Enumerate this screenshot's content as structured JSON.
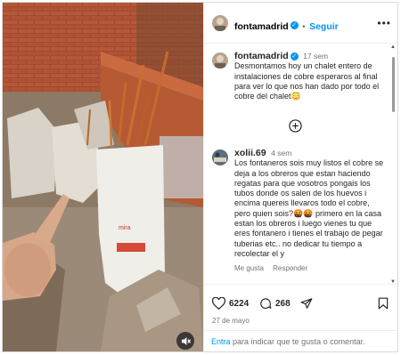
{
  "post": {
    "author": "fontamadrid",
    "follow_label": "Seguir",
    "dot": "•",
    "more": "•••",
    "caption_author": "fontamadrid",
    "caption_time": "17 sem",
    "caption_text": "Desmontamos hoy un chalet entero de instalaciones de cobre esperaros al final para ver lo que nos han dado por todo el cobre del chalet",
    "caption_emoji": "😳"
  },
  "comment": {
    "author": "xolii.69",
    "time": "4 sem",
    "text": "Los fontaneros sois muy listos el cobre se deja a los obreros que estan haciendo regatas para que vosotros pongais los tubos donde os salen de los huevos i encima quereis llevaros todo el cobre, pero quien sois?🤬🤬 primero en la casa estan los obreros i luego vienes tu que eres fontanero i tienes el trabajo de pegar tuberias etc.. no dedicar tu tiempo a recolectar el y",
    "like_label": "Me gusta",
    "reply_label": "Responder"
  },
  "actions": {
    "likes": "6224",
    "comments": "268",
    "date": "27 de mayo"
  },
  "footer": {
    "link": "Entra",
    "rest": " para indicar que te gusta o comentar."
  },
  "colors": {
    "accent": "#0095f6",
    "verified": "#0095f6"
  },
  "icons": [
    "verified-badge-icon",
    "more-options-icon",
    "add-comment-icon",
    "heart-icon",
    "comment-icon",
    "share-icon",
    "save-icon",
    "mute-icon"
  ]
}
